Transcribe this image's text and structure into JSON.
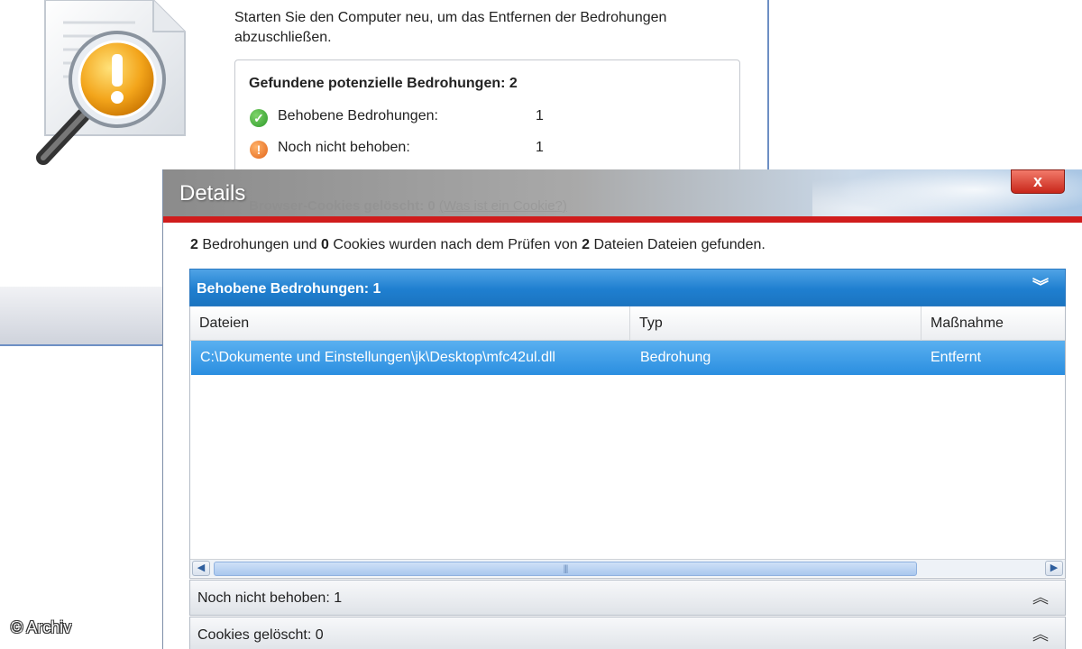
{
  "background_window": {
    "restart_message": "Starten Sie den Computer neu, um das Entfernen der Bedrohungen abzuschließen.",
    "threat_box": {
      "title": "Gefundene potenzielle Bedrohungen: 2",
      "rows": [
        {
          "label": "Behobene Bedrohungen:",
          "value": "1",
          "icon": "checkmark-icon",
          "color": "#2d9a2a"
        },
        {
          "label": "Noch nicht behoben:",
          "value": "1",
          "icon": "exclamation-icon",
          "color": "#e2641a"
        }
      ],
      "cookies_label": "Browser-Cookies gelöscht: 0",
      "cookies_link": "(Was ist ein Cookie?)"
    }
  },
  "details_dialog": {
    "title": "Details",
    "close_label": "x",
    "summary": {
      "threats": "2",
      "part1": " Bedrohungen und ",
      "cookies": "0",
      "part2": " Cookies wurden nach dem Prüfen von ",
      "files": "2",
      "part3": " Dateien Dateien gefunden."
    },
    "sections": {
      "fixed": {
        "label": "Behobene Bedrohungen: 1",
        "chevron": "expanded-chevron-icon"
      },
      "unfixed": {
        "label": "Noch nicht behoben: 1",
        "chevron": "collapsed-chevron-icon"
      },
      "cookies": {
        "label": "Cookies gelöscht: 0",
        "chevron": "collapsed-chevron-icon"
      }
    },
    "table": {
      "columns": [
        "Dateien",
        "Typ",
        "Maßnahme"
      ],
      "rows": [
        [
          "C:\\Dokumente und Einstellungen\\jk\\Desktop\\mfc42ul.dll",
          "Bedrohung",
          "Entfernt"
        ]
      ]
    },
    "colors": {
      "accent_blue": "#1f7fd0",
      "title_red_line": "#d01c1c",
      "close_red": "#c8261a"
    }
  },
  "copyright": "© Archiv"
}
